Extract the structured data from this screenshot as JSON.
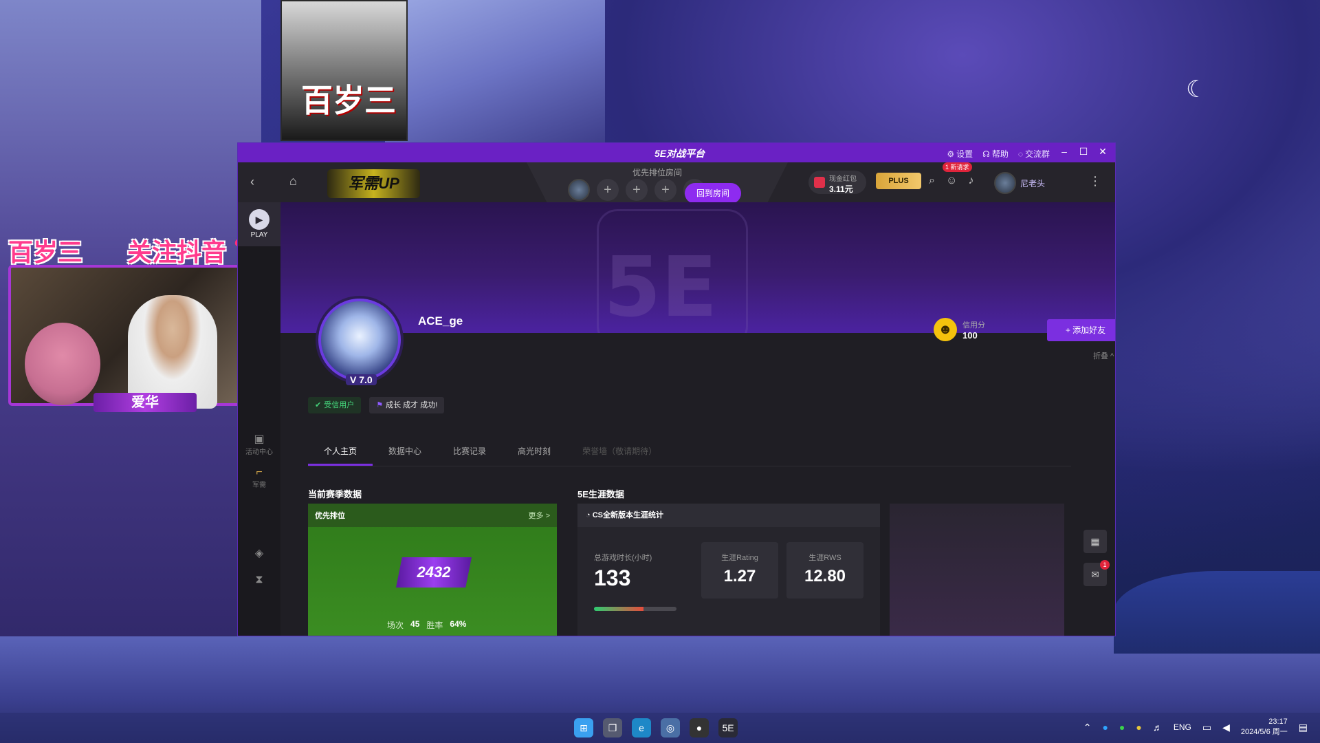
{
  "desktop": {
    "poster_title": "百岁三",
    "stream_banner_left": "百岁三",
    "stream_banner_right": "关注抖音",
    "webcam_name": "爱华"
  },
  "titlebar": {
    "logo": "5E对战平台",
    "links": [
      {
        "icon": "gear-icon",
        "glyph": "⚙",
        "label": "设置"
      },
      {
        "icon": "headset-icon",
        "glyph": "☊",
        "label": "帮助"
      },
      {
        "icon": "chat-bubble-icon",
        "glyph": "◌",
        "label": "交流群"
      }
    ],
    "controls": {
      "minimize": "–",
      "maximize": "☐",
      "close": "✕"
    }
  },
  "topbar": {
    "brand": "军需UP",
    "queue_label": "优先排位房间",
    "slot_add": "+",
    "return_room": "回到房间",
    "cash_label": "现金红包",
    "cash_amount": "3.11元",
    "plus": "PLUS",
    "request_badge": "1 新请求",
    "username": "尼老头"
  },
  "sidebar": {
    "play": "PLAY",
    "items": [
      {
        "label": "活动中心",
        "glyph": "🎁"
      },
      {
        "label": "军需",
        "glyph": "🔫"
      }
    ]
  },
  "hero": {
    "logo": "5E"
  },
  "profile": {
    "username": "ACE_ge",
    "level": "V 7.0",
    "credit_label": "信用分",
    "credit_value": "100",
    "add_friend": "+ 添加好友",
    "collapse": "折叠 ^",
    "tag_verified": "受信用户",
    "tag_growth": "成长 成才 成功!"
  },
  "tabs": [
    {
      "label": "个人主页",
      "state": "active"
    },
    {
      "label": "数据中心",
      "state": "normal"
    },
    {
      "label": "比赛记录",
      "state": "normal"
    },
    {
      "label": "高光时刻",
      "state": "normal"
    },
    {
      "label": "荣誉墙（敬请期待）",
      "state": "disabled"
    }
  ],
  "season": {
    "title": "当前赛季数据",
    "card_title": "优先排位",
    "more": "更多 >",
    "elo": "2432",
    "matches_label": "场次",
    "matches_value": "45",
    "winrate_label": "胜率",
    "winrate_value": "64%"
  },
  "career": {
    "title": "5E生涯数据",
    "card_title": "CS全新版本生涯统计",
    "hours_label": "总游戏时长(小时)",
    "hours_value": "133",
    "rating_label": "生涯Rating",
    "rating_value": "1.27",
    "rws_label": "生涯RWS",
    "rws_value": "12.80"
  },
  "float": {
    "badge": "1"
  },
  "taskbar": {
    "lang": "ENG",
    "time": "23:17",
    "date": "2024/5/6 周一"
  },
  "colors": {
    "accent": "#7b2fe0",
    "titlebar": "#6a21c4",
    "verified": "#44d37a",
    "season_card": "#3b8d22"
  }
}
